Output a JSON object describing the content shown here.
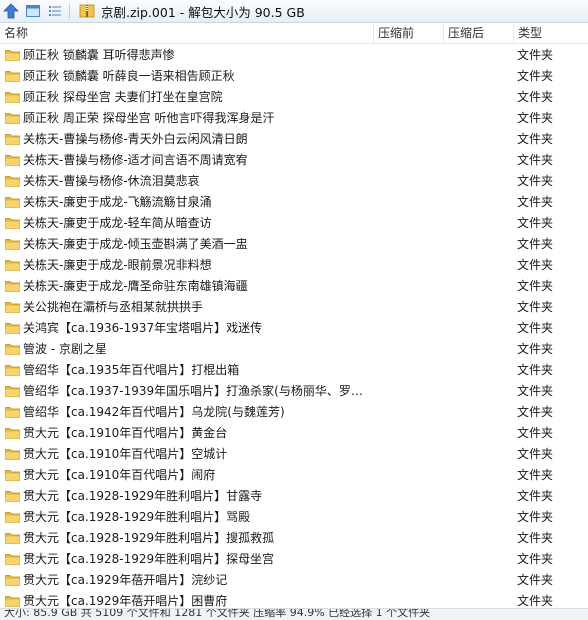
{
  "toolbar": {
    "up_icon": "up-arrow-icon",
    "view_icon": "window-view-icon",
    "details_icon": "details-view-icon",
    "archive_icon": "zip-archive-icon"
  },
  "address": {
    "text": "京剧.zip.001 - 解包大小为 90.5 GB"
  },
  "columns": {
    "name": "名称",
    "compressed": "压缩前",
    "packed": "压缩后",
    "type": "类型"
  },
  "rows": [
    {
      "name": "顾正秋 锁麟囊 耳听得悲声惨",
      "type": "文件夹"
    },
    {
      "name": "顾正秋 锁麟囊 听薛良一语来相告顾正秋",
      "type": "文件夹"
    },
    {
      "name": "顾正秋 探母坐宫 夫妻们打坐在皇宫院",
      "type": "文件夹"
    },
    {
      "name": "顾正秋 周正荣 探母坐宫 听他言吓得我浑身是汗",
      "type": "文件夹"
    },
    {
      "name": "关栋天-曹操与杨修-青天外白云闲风清日朗",
      "type": "文件夹"
    },
    {
      "name": "关栋天-曹操与杨修-适才间言语不周请宽宥",
      "type": "文件夹"
    },
    {
      "name": "关栋天-曹操与杨修-休流泪莫悲哀",
      "type": "文件夹"
    },
    {
      "name": "关栋天-廉吏于成龙-飞觞流觞甘泉涌",
      "type": "文件夹"
    },
    {
      "name": "关栋天-廉吏于成龙-轻车简从暗查访",
      "type": "文件夹"
    },
    {
      "name": "关栋天-廉吏于成龙-倾玉壶斟满了美酒一盅",
      "type": "文件夹"
    },
    {
      "name": "关栋天-廉吏于成龙-眼前景况非料想",
      "type": "文件夹"
    },
    {
      "name": "关栋天-廉吏于成龙-膺圣命驻东南雄镇海疆",
      "type": "文件夹"
    },
    {
      "name": "关公挑袍在灞桥与丞相某就拱拱手",
      "type": "文件夹"
    },
    {
      "name": "关鸿宾【ca.1936-1937年宝塔唱片】戏迷传",
      "type": "文件夹"
    },
    {
      "name": "管波 - 京剧之星",
      "type": "文件夹"
    },
    {
      "name": "管绍华【ca.1935年百代唱片】打棍出箱",
      "type": "文件夹"
    },
    {
      "name": "管绍华【ca.1937-1939年国乐唱片】打渔杀家(与杨丽华、罗小...",
      "type": "文件夹"
    },
    {
      "name": "管绍华【ca.1942年百代唱片】乌龙院(与魏莲芳)",
      "type": "文件夹"
    },
    {
      "name": "贯大元【ca.1910年百代唱片】黄金台",
      "type": "文件夹"
    },
    {
      "name": "贯大元【ca.1910年百代唱片】空城计",
      "type": "文件夹"
    },
    {
      "name": "贯大元【ca.1910年百代唱片】闹府",
      "type": "文件夹"
    },
    {
      "name": "贯大元【ca.1928-1929年胜利唱片】甘露寺",
      "type": "文件夹"
    },
    {
      "name": "贯大元【ca.1928-1929年胜利唱片】骂殿",
      "type": "文件夹"
    },
    {
      "name": "贯大元【ca.1928-1929年胜利唱片】搜孤救孤",
      "type": "文件夹"
    },
    {
      "name": "贯大元【ca.1928-1929年胜利唱片】探母坐宫",
      "type": "文件夹"
    },
    {
      "name": "贯大元【ca.1929年蓓开唱片】浣纱记",
      "type": "文件夹"
    },
    {
      "name": "贯大元【ca.1929年蓓开唱片】困曹府",
      "type": "文件夹"
    }
  ],
  "status": {
    "text": "大小: 85.9 GB 共 5109 个文件和 1281 个文件夹 压缩率 94.9% 已经选择 1 个文件夹"
  }
}
